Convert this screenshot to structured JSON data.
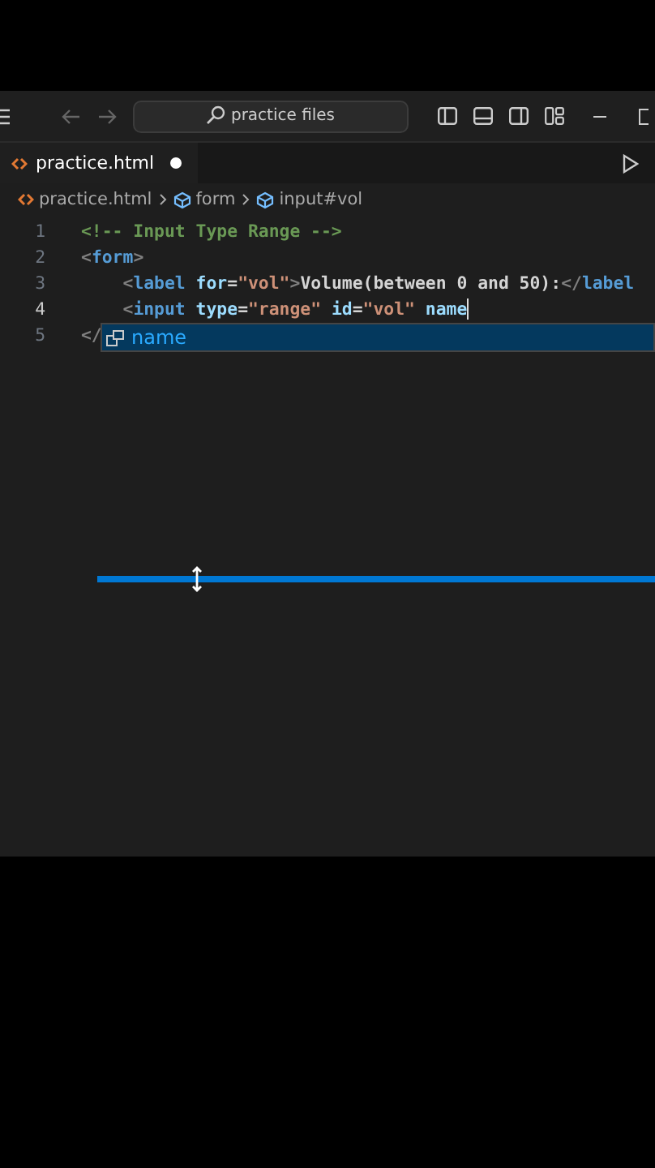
{
  "title_bar": {
    "search": "practice files"
  },
  "tabs": [
    {
      "label": "practice.html",
      "selected": true,
      "modified": true
    }
  ],
  "breadcrumbs": [
    {
      "label": "practice.html",
      "kind": "file"
    },
    {
      "label": "form",
      "kind": "symbol"
    },
    {
      "label": "input#vol",
      "kind": "symbol"
    }
  ],
  "editor": {
    "lines": [
      {
        "number": "1",
        "current": false,
        "tokens": [
          {
            "text": "<!-- Input Type Range -->",
            "kind": "comment"
          }
        ]
      },
      {
        "number": "2",
        "current": false,
        "tokens": [
          {
            "text": "<",
            "kind": "punct"
          },
          {
            "text": "form",
            "kind": "tag"
          },
          {
            "text": ">",
            "kind": "punct"
          }
        ]
      },
      {
        "number": "3",
        "current": false,
        "tokens": [
          {
            "text": "    <",
            "kind": "punct"
          },
          {
            "text": "label",
            "kind": "tag"
          },
          {
            "text": " for",
            "kind": "attr"
          },
          {
            "text": "=",
            "kind": "text"
          },
          {
            "text": "\"vol\"",
            "kind": "string"
          },
          {
            "text": ">",
            "kind": "punct"
          },
          {
            "text": "Volume(between 0 and 50):",
            "kind": "text"
          },
          {
            "text": "</",
            "kind": "punct"
          },
          {
            "text": "label",
            "kind": "tag"
          }
        ]
      },
      {
        "number": "4",
        "current": true,
        "tokens": [
          {
            "text": "    <",
            "kind": "punct"
          },
          {
            "text": "input",
            "kind": "tag"
          },
          {
            "text": " type",
            "kind": "attr"
          },
          {
            "text": "=",
            "kind": "text"
          },
          {
            "text": "\"range\"",
            "kind": "string"
          },
          {
            "text": " id",
            "kind": "attr"
          },
          {
            "text": "=",
            "kind": "text"
          },
          {
            "text": "\"vol\"",
            "kind": "string"
          },
          {
            "text": " name",
            "kind": "attr"
          }
        ]
      },
      {
        "number": "5",
        "current": false,
        "tokens": [
          {
            "text": "</",
            "kind": "punct"
          }
        ]
      }
    ]
  },
  "suggestions": [
    {
      "label": "name",
      "selected": true
    }
  ]
}
